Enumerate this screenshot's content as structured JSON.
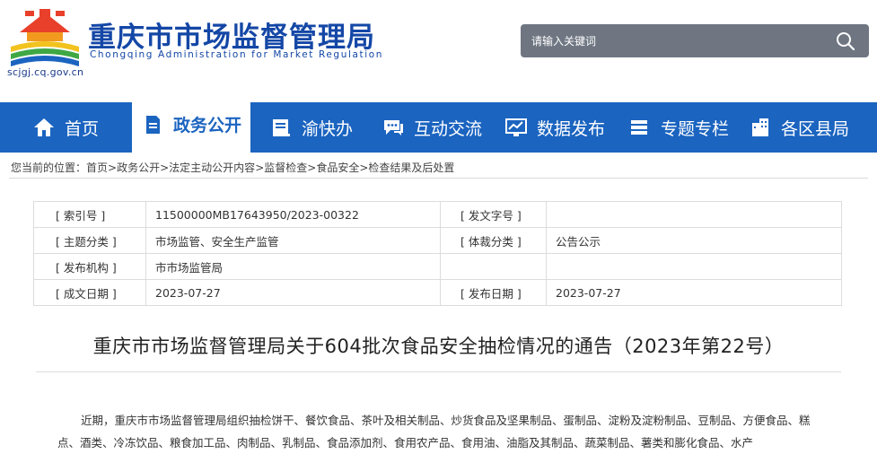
{
  "header": {
    "title": "重庆市市场监督管理局",
    "subtitle": "Chongqing Administration for Market Regulation",
    "domain": "scjgj.cq.gov.cn",
    "search_placeholder": "请输入关键词",
    "logo_icon": "cq-emblem-icon",
    "search_icon": "search-icon"
  },
  "nav": {
    "items": [
      {
        "label": "首页",
        "icon": "home-icon"
      },
      {
        "label": "政务公开",
        "icon": "document-icon"
      },
      {
        "label": "渝快办",
        "icon": "book-icon"
      },
      {
        "label": "互动交流",
        "icon": "chat-icon"
      },
      {
        "label": "数据发布",
        "icon": "chart-icon"
      },
      {
        "label": "专题专栏",
        "icon": "list-icon"
      },
      {
        "label": "各区县局",
        "icon": "building-icon"
      }
    ],
    "active_index": 1
  },
  "breadcrumb": {
    "prefix": "您当前的位置：",
    "items": [
      "首页",
      "政务公开",
      "法定主动公开内容",
      "监督检查",
      "食品安全",
      "检查结果及后处置"
    ],
    "separator": ">"
  },
  "meta": {
    "rows": [
      [
        "[ 索引号 ]",
        "11500000MB17643950/2023-00322",
        "[ 发文字号 ]",
        ""
      ],
      [
        "[ 主题分类 ]",
        "市场监管、安全生产监管",
        "[ 体裁分类 ]",
        "公告公示"
      ],
      [
        "[ 发布机构 ]",
        "市市场监管局",
        "",
        ""
      ],
      [
        "[ 成文日期 ]",
        "2023-07-27",
        "[ 发布日期 ]",
        "2023-07-27"
      ]
    ]
  },
  "document": {
    "title": "重庆市市场监督管理局关于604批次食品安全抽检情况的通告（2023年第22号）",
    "body": "近期，重庆市市场监督管理局组织抽检饼干、餐饮食品、茶叶及相关制品、炒货食品及坚果制品、蛋制品、淀粉及淀粉制品、豆制品、方便食品、糕点、酒类、冷冻饮品、粮食加工品、肉制品、乳制品、食品添加剂、食用农产品、食用油、油脂及其制品、蔬菜制品、薯类和膨化食品、水产"
  },
  "colors": {
    "brand_blue": "#1447a6",
    "nav_blue": "#1b64c0",
    "search_bg": "#6f7682"
  }
}
